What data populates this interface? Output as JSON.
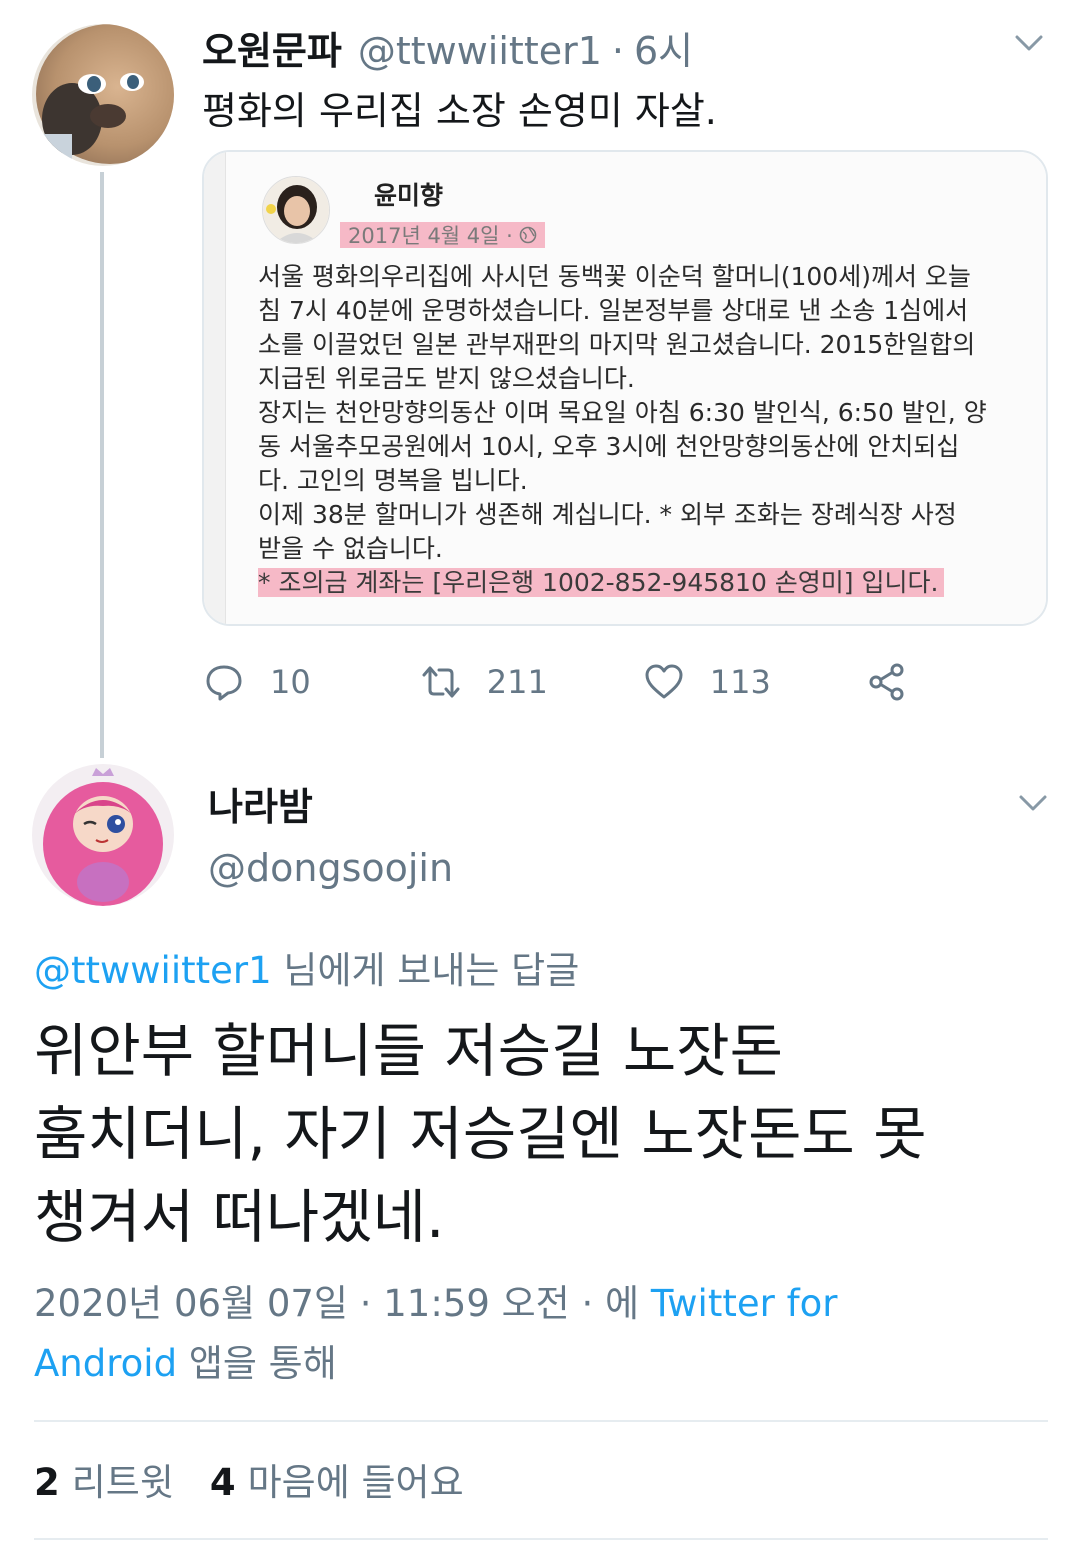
{
  "tweet": {
    "author_name": "오원문파",
    "handle": "@ttwwiitter1",
    "separator": "·",
    "time_ago": "6시",
    "text": "평화의 우리집 소장 손영미 자살.",
    "embedded_post": {
      "author": "윤미향",
      "date": "2017년 4월 4일 ·",
      "lines": [
        "서울 평화의우리집에 사시던 동백꽃 이순덕 할머니(100세)께서 오늘",
        "침 7시 40분에 운명하셨습니다.  일본정부를 상대로 낸 소송 1심에서",
        "소를 이끌었던 일본 관부재판의 마지막 원고셨습니다. 2015한일합의",
        "지급된 위로금도 받지 않으셨습니다.",
        "장지는 천안망향의동산 이며 목요일 아침 6:30 발인식, 6:50 발인, 양",
        "동 서울추모공원에서 10시, 오후 3시에 천안망향의동산에 안치되십",
        "다.  고인의 명복을 빕니다.",
        "이제 38분 할머니가 생존해 계십니다.  * 외부 조화는 장례식장 사정",
        "받을 수 없습니다."
      ],
      "highlight_line": "* 조의금 계좌는 [우리은행 1002-852-945810 손영미] 입니다."
    },
    "actions": {
      "reply_count": "10",
      "retweet_count": "211",
      "like_count": "113"
    }
  },
  "reply": {
    "author_name": "나라밤",
    "handle": "@dongsoojin",
    "reply_to_handle": "@ttwwiitter1",
    "reply_to_suffix": " 님에게 보내는 답글",
    "text_lines": [
      "위안부 할머니들 저승길 노잣돈",
      "훔치더니, 자기 저승길엔 노잣돈도 못",
      "챙겨서 떠나겠네."
    ],
    "meta": {
      "date_time": "2020년 06월 07일 · 11:59 오전 · 에 ",
      "client_part1": "Twitter for",
      "client_part2": "Android",
      "via_suffix": " 앱을 통해"
    },
    "stats": {
      "retweets": "2",
      "retweets_label": "리트윗",
      "likes": "4",
      "likes_label": "마음에 들어요"
    }
  },
  "colors": {
    "link": "#1da1f2",
    "secondary_text": "#657786",
    "primary_text": "#14171a",
    "highlight": "#f6b9c7"
  },
  "icons": [
    "chevron-down-icon",
    "reply-icon",
    "retweet-icon",
    "like-icon",
    "share-icon",
    "globe-icon"
  ]
}
